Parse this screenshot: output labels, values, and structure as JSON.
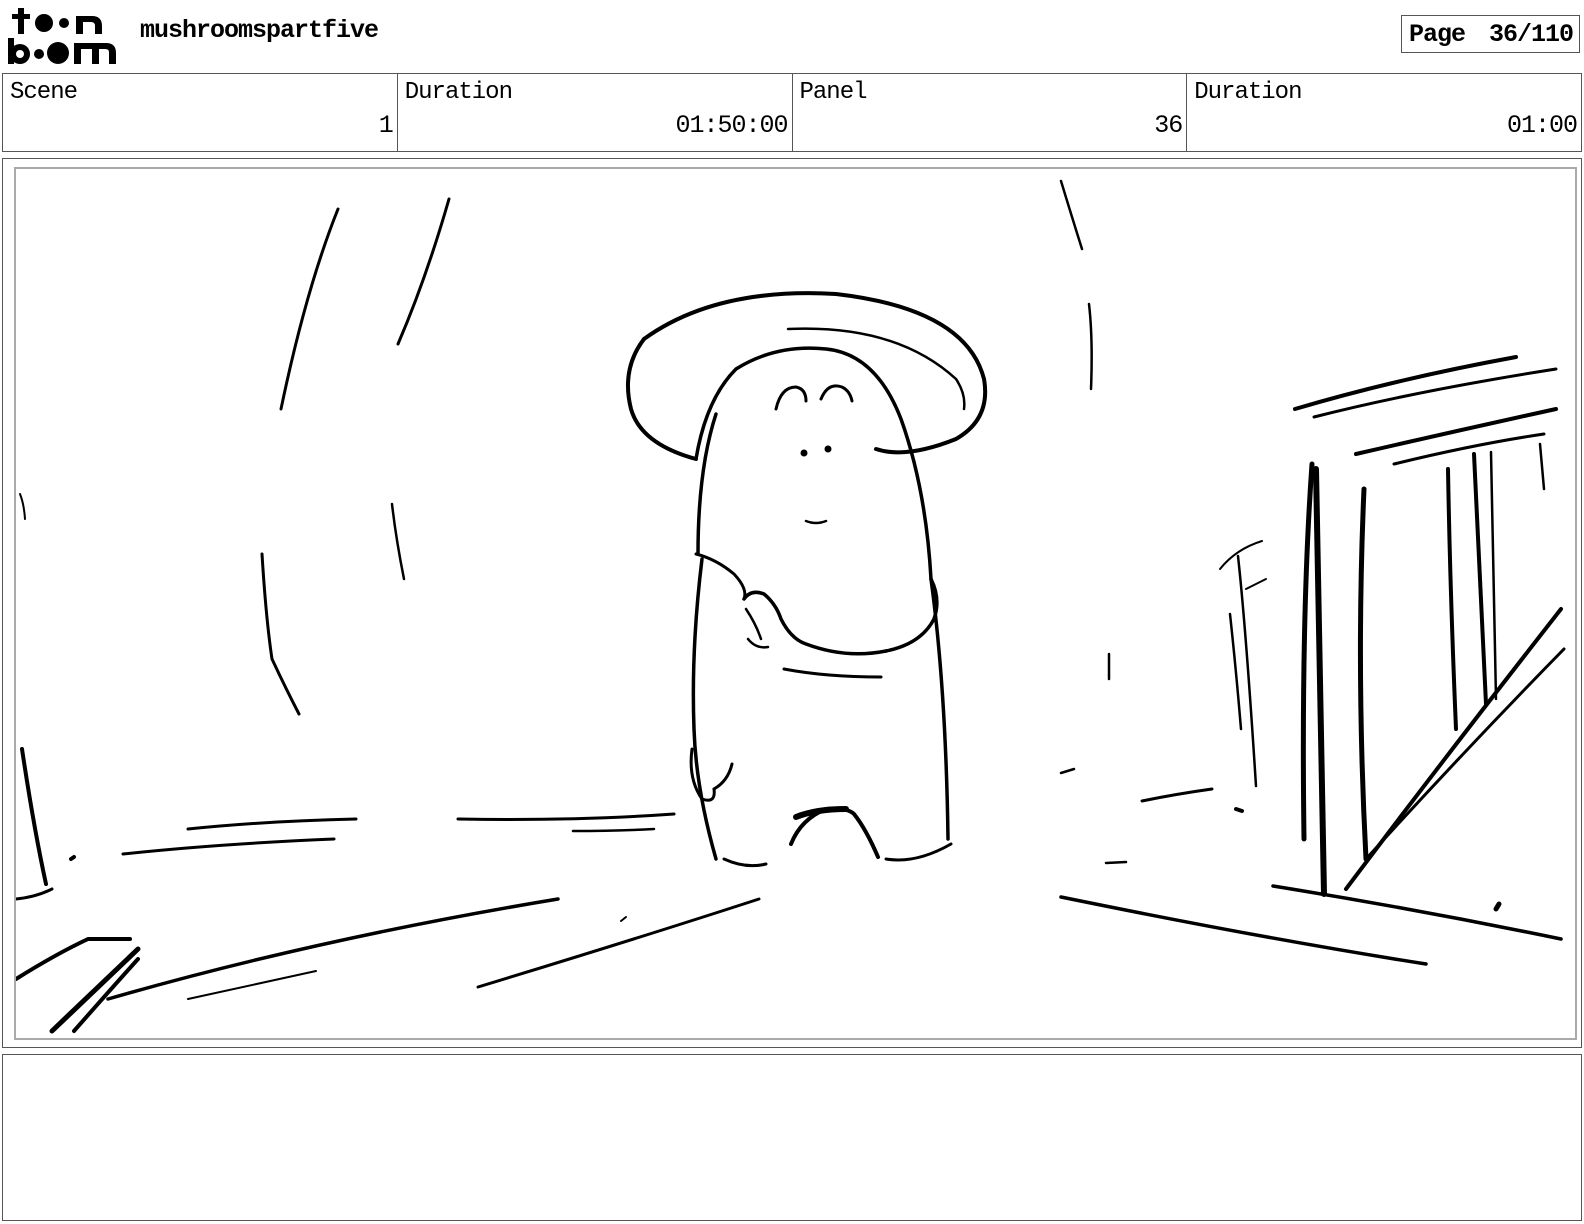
{
  "header": {
    "logo_text": "toon boom",
    "project_title": "mushroomspartfive",
    "page_label": "Page",
    "page_number": "36/110"
  },
  "info": {
    "scene_label": "Scene",
    "scene_value": "1",
    "scene_duration_label": "Duration",
    "scene_duration_value": "01:50:00",
    "panel_label": "Panel",
    "panel_value": "36",
    "panel_duration_label": "Duration",
    "panel_duration_value": "01:00"
  },
  "notes": {
    "text": ""
  }
}
